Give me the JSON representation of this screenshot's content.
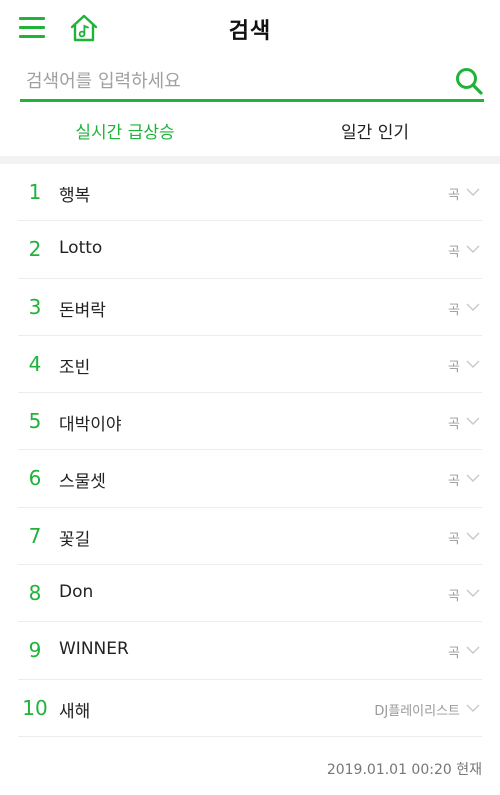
{
  "header": {
    "title": "검색"
  },
  "search": {
    "placeholder": "검색어를 입력하세요"
  },
  "tabs": [
    {
      "label": "실시간 급상승",
      "active": true
    },
    {
      "label": "일간 인기",
      "active": false
    }
  ],
  "ranking": [
    {
      "rank": "1",
      "title": "행복",
      "type": "곡"
    },
    {
      "rank": "2",
      "title": "Lotto",
      "type": "곡"
    },
    {
      "rank": "3",
      "title": "돈벼락",
      "type": "곡"
    },
    {
      "rank": "4",
      "title": "조빈",
      "type": "곡"
    },
    {
      "rank": "5",
      "title": "대박이야",
      "type": "곡"
    },
    {
      "rank": "6",
      "title": "스물셋",
      "type": "곡"
    },
    {
      "rank": "7",
      "title": "꽃길",
      "type": "곡"
    },
    {
      "rank": "8",
      "title": "Don",
      "type": "곡"
    },
    {
      "rank": "9",
      "title": "WINNER",
      "type": "곡"
    },
    {
      "rank": "10",
      "title": "새해",
      "type": "DJ플레이리스트"
    }
  ],
  "footer": {
    "timestamp": "2019.01.01 00:20 현재"
  },
  "colors": {
    "accent": "#1fb33a",
    "text": "#222222",
    "muted": "#999999",
    "divider": "#ececec"
  },
  "icons": {
    "menu": "hamburger-menu-icon",
    "home": "music-home-icon",
    "search": "search-icon",
    "expand": "chevron-down-icon"
  }
}
